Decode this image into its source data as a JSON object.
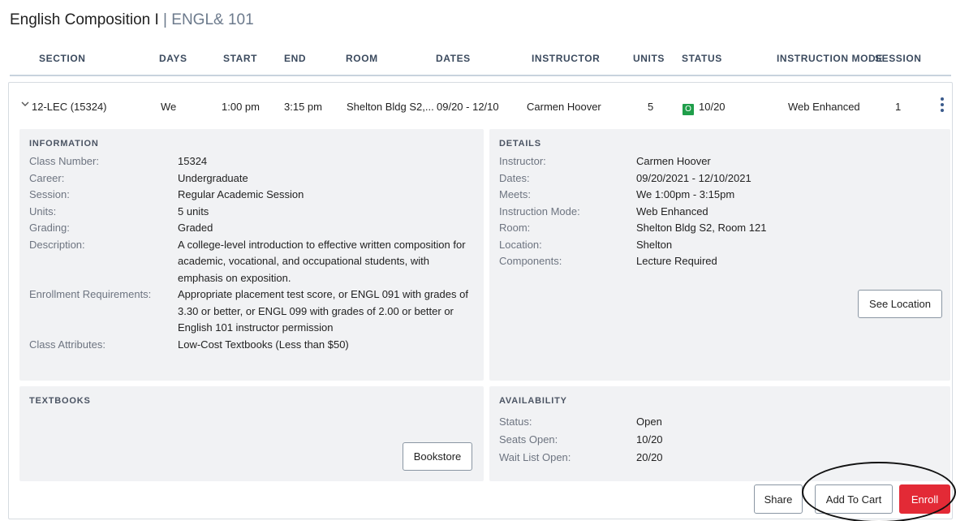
{
  "course": {
    "name": "English Composition I",
    "separator": "|",
    "code": "ENGL& 101"
  },
  "columns": {
    "section": "SECTION",
    "days": "DAYS",
    "start": "START",
    "end": "END",
    "room": "ROOM",
    "dates": "DATES",
    "instructor": "INSTRUCTOR",
    "units": "UNITS",
    "status": "STATUS",
    "instruction_mode": "INSTRUCTION MODE",
    "session": "SESSION"
  },
  "row": {
    "section": "12-LEC (15324)",
    "days": "We",
    "start": "1:00 pm",
    "end": "3:15 pm",
    "room": "Shelton Bldg S2,...",
    "dates": "09/20 - 12/10",
    "instructor": "Carmen Hoover",
    "units": "5",
    "status_badge": "O",
    "status_badge_color": "#1f9e4a",
    "status": "10/20",
    "instruction_mode": "Web Enhanced",
    "session": "1"
  },
  "information": {
    "title": "INFORMATION",
    "class_number_label": "Class Number:",
    "class_number": "15324",
    "career_label": "Career:",
    "career": "Undergraduate",
    "session_label": "Session:",
    "session": "Regular Academic Session",
    "units_label": "Units:",
    "units": "5 units",
    "grading_label": "Grading:",
    "grading": "Graded",
    "description_label": "Description:",
    "description": "A college-level introduction to effective written composition for academic, vocational, and occupational students, with emphasis on exposition.",
    "enrollment_label": "Enrollment Requirements:",
    "enrollment": "Appropriate placement test score, or ENGL 091 with grades of 3.30 or better, or ENGL 099 with grades of 2.00 or better or English 101 instructor permission",
    "attributes_label": "Class Attributes:",
    "attributes": "Low-Cost Textbooks (Less than $50)"
  },
  "details": {
    "title": "DETAILS",
    "instructor_label": "Instructor:",
    "instructor": "Carmen Hoover",
    "dates_label": "Dates:",
    "dates": "09/20/2021 - 12/10/2021",
    "meets_label": "Meets:",
    "meets": "We 1:00pm - 3:15pm",
    "mode_label": "Instruction Mode:",
    "mode": "Web Enhanced",
    "room_label": "Room:",
    "room": "Shelton Bldg S2, Room 121",
    "location_label": "Location:",
    "location": "Shelton",
    "components_label": "Components:",
    "components": "Lecture Required",
    "see_location": "See Location"
  },
  "textbooks": {
    "title": "TEXTBOOKS",
    "bookstore": "Bookstore"
  },
  "availability": {
    "title": "AVAILABILITY",
    "status_label": "Status:",
    "status": "Open",
    "seats_label": "Seats Open:",
    "seats": "10/20",
    "waitlist_label": "Wait List Open:",
    "waitlist": "20/20"
  },
  "actions": {
    "share": "Share",
    "add_to_cart": "Add To Cart",
    "enroll": "Enroll",
    "enroll_color": "#e32a36"
  },
  "icons": {
    "expand": "chevron-down-icon",
    "more": "kebab-menu-icon"
  }
}
